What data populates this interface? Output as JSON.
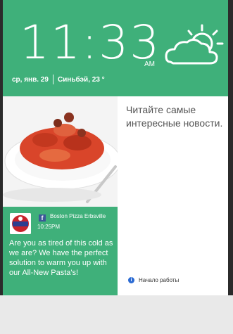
{
  "lockscreen": {
    "time": "11:33",
    "ampm": "AM",
    "date": "ср, янв. 29",
    "weather": "Синьбэй, 23 °"
  },
  "post": {
    "author": "Boston Pizza Erbsville",
    "time": "10:25PM",
    "text": "Are you as tired of this cold as we are? We have the perfect solution to warm you up with our All-New Pasta's!"
  },
  "news": {
    "message": "Читайте самые интересные новости.",
    "start_label": "Начало работы"
  },
  "icons": {
    "weather": "partly-sunny-icon",
    "facebook": "facebook-icon",
    "info": "info-icon"
  },
  "colors": {
    "accent": "#3fb07a",
    "accent_dark": "#2e9663"
  }
}
